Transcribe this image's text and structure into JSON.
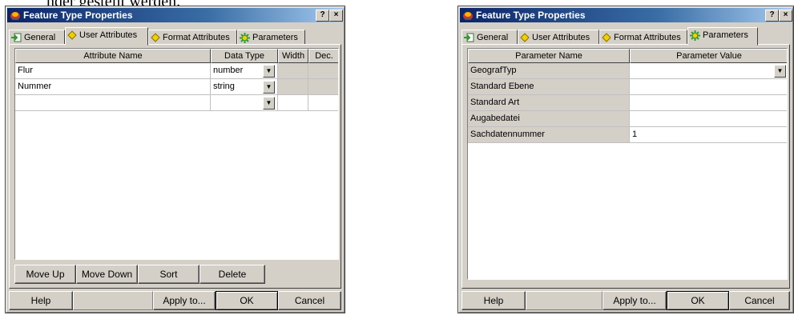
{
  "background_fragment": "nder gestellt werden.",
  "dialog_left": {
    "title": "Feature Type Properties",
    "help_glyph": "?",
    "close_glyph": "×",
    "tabs": [
      {
        "label": "General",
        "icon": "general-icon"
      },
      {
        "label": "User Attributes",
        "icon": "diamond-icon"
      },
      {
        "label": "Format Attributes",
        "icon": "diamond-icon"
      },
      {
        "label": "Parameters",
        "icon": "gear-icon"
      }
    ],
    "active_tab": "User Attributes",
    "columns": [
      "Attribute Name",
      "Data Type",
      "Width",
      "Dec."
    ],
    "rows": [
      {
        "name": "Flur",
        "type": "number",
        "width": "",
        "dec": ""
      },
      {
        "name": "Nummer",
        "type": "string",
        "width": "",
        "dec": ""
      },
      {
        "name": "",
        "type": "",
        "width": "",
        "dec": ""
      }
    ],
    "list_buttons": [
      "Move Up",
      "Move Down",
      "Sort",
      "Delete"
    ],
    "footer": {
      "help": "Help",
      "apply": "Apply to...",
      "ok": "OK",
      "cancel": "Cancel"
    }
  },
  "dialog_right": {
    "title": "Feature Type Properties",
    "help_glyph": "?",
    "close_glyph": "×",
    "tabs": [
      {
        "label": "General",
        "icon": "general-icon"
      },
      {
        "label": "User Attributes",
        "icon": "diamond-icon"
      },
      {
        "label": "Format Attributes",
        "icon": "diamond-icon"
      },
      {
        "label": "Parameters",
        "icon": "gear-icon"
      }
    ],
    "active_tab": "Parameters",
    "columns": [
      "Parameter Name",
      "Parameter Value"
    ],
    "rows": [
      {
        "name": "GeografTyp",
        "value": "",
        "has_dropdown": true
      },
      {
        "name": "Standard Ebene",
        "value": ""
      },
      {
        "name": "Standard Art",
        "value": ""
      },
      {
        "name": "Augabedatei",
        "value": ""
      },
      {
        "name": "Sachdatennummer",
        "value": "1"
      }
    ],
    "footer": {
      "help": "Help",
      "apply": "Apply to...",
      "ok": "OK",
      "cancel": "Cancel"
    }
  },
  "colors": {
    "dialog_face": "#d4d0c8",
    "title_start": "#0a246a",
    "title_end": "#a6caf0",
    "icon_yellow": "#f2d000",
    "icon_green": "#2f9a2f"
  }
}
